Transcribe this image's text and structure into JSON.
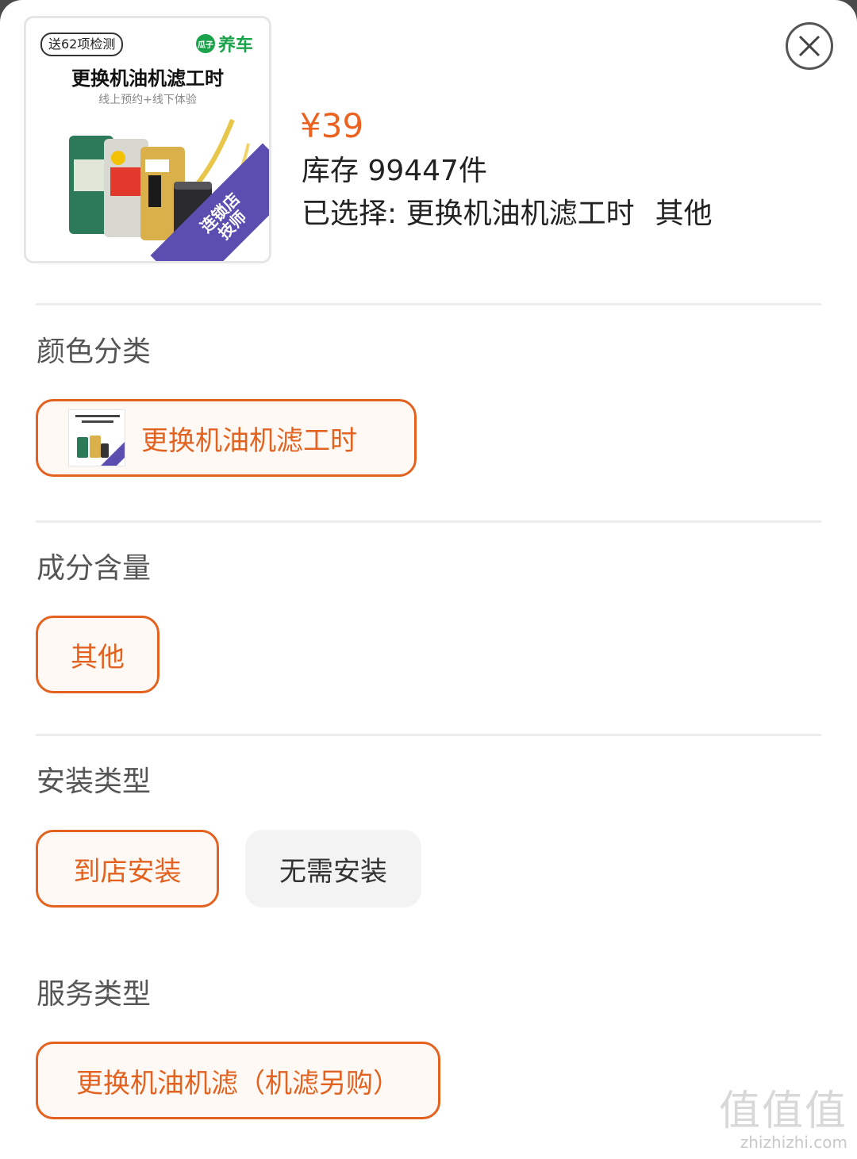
{
  "product": {
    "price": "¥39",
    "stock": "库存 99447件",
    "selected_prefix": "已选择: ",
    "selected_option1": "更换机油机滤工时",
    "selected_option2": "其他",
    "thumbnail": {
      "badge": "送62项检测",
      "brand_mark": "瓜子",
      "brand": "养车",
      "title": "更换机油机滤工时",
      "subtitle": "线上预约+线下体验",
      "ribbon_line1": "连锁店",
      "ribbon_line2": "技师"
    }
  },
  "sections": {
    "color": {
      "title": "颜色分类",
      "options": [
        {
          "label": "更换机油机滤工时",
          "selected": true
        }
      ]
    },
    "composition": {
      "title": "成分含量",
      "options": [
        {
          "label": "其他",
          "selected": true
        }
      ]
    },
    "install": {
      "title": "安装类型",
      "options": [
        {
          "label": "到店安装",
          "selected": true
        },
        {
          "label": "无需安装",
          "selected": false
        }
      ]
    },
    "service": {
      "title": "服务类型",
      "options": [
        {
          "label": "更换机油机滤（机滤另购）",
          "selected": true
        }
      ]
    }
  },
  "icons": {
    "close": "close-icon"
  },
  "colors": {
    "accent": "#e3621f",
    "price": "#ec6321",
    "ribbon": "#5a4fb0",
    "brand_green": "#1aa34a"
  },
  "watermark": {
    "logo": "值值值",
    "url": "zhizhizhi.com"
  }
}
